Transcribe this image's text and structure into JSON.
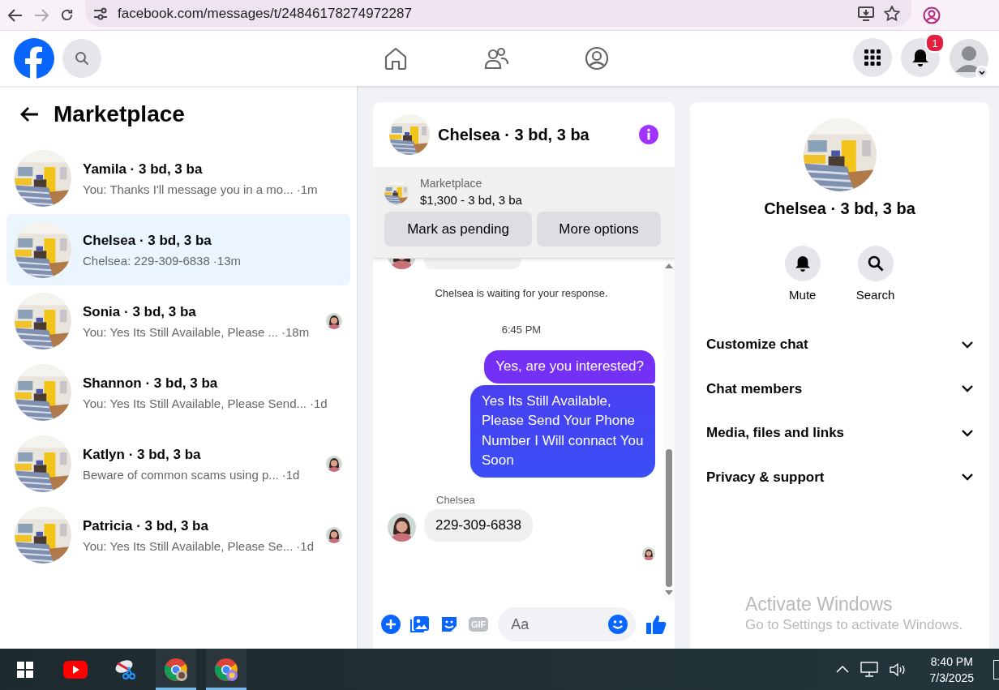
{
  "browser": {
    "url": "facebook.com/messages/t/24846178274972287"
  },
  "header": {
    "notification_badge": "1"
  },
  "sidebar": {
    "title": "Marketplace",
    "conversations": [
      {
        "name": "Yamila · 3 bd, 3 ba",
        "preview": "You: Thanks I'll message you in a mo...",
        "time": "·1m",
        "selected": false,
        "read_receipt": false
      },
      {
        "name": "Chelsea · 3 bd, 3 ba",
        "preview": "Chelsea: 229-309-6838",
        "time": "·13m",
        "selected": true,
        "read_receipt": false
      },
      {
        "name": "Sonia · 3 bd, 3 ba",
        "preview": "You: Yes Its Still Available, Please ...",
        "time": "·18m",
        "selected": false,
        "read_receipt": true
      },
      {
        "name": "Shannon · 3 bd, 3 ba",
        "preview": "You: Yes Its Still Available, Please Send...",
        "time": "·1d",
        "selected": false,
        "read_receipt": false
      },
      {
        "name": "Katlyn · 3 bd, 3 ba",
        "preview": "Beware of common scams using p...",
        "time": "·1d",
        "selected": false,
        "read_receipt": true
      },
      {
        "name": "Patricia · 3 bd, 3 ba",
        "preview": "You: Yes Its Still Available, Please Se...",
        "time": "·1d",
        "selected": false,
        "read_receipt": true
      }
    ]
  },
  "chat": {
    "title": "Chelsea · 3 bd, 3 ba",
    "listing": {
      "label": "Marketplace",
      "detail": "$1,300 - 3 bd, 3 ba"
    },
    "actions": [
      "Mark as pending",
      "More options"
    ],
    "messages": [
      {
        "kind": "partial"
      },
      {
        "kind": "notice",
        "text": "Chelsea is waiting for your response."
      },
      {
        "kind": "time",
        "text": "6:45 PM"
      },
      {
        "kind": "outgoing",
        "text": "Yes, are you interested?"
      },
      {
        "kind": "outgoing",
        "text": "Yes Its Still Available, Please Send Your Phone Number I Will connact You Soon"
      },
      {
        "kind": "sender",
        "text": "Chelsea"
      },
      {
        "kind": "incoming",
        "text": "229-309-6838"
      },
      {
        "kind": "seen"
      }
    ],
    "composer": {
      "placeholder": "Aa",
      "gif_label": "GIF"
    }
  },
  "details": {
    "title": "Chelsea · 3 bd, 3 ba",
    "actions": [
      {
        "kind": "mute",
        "label": "Mute"
      },
      {
        "kind": "search",
        "label": "Search"
      }
    ],
    "sections": [
      {
        "label": "Customize chat",
        "expanded": false
      },
      {
        "label": "Chat members",
        "expanded": false
      },
      {
        "label": "Media, files and links",
        "expanded": false
      },
      {
        "label": "Privacy & support",
        "expanded": false
      }
    ]
  },
  "activation_notice": {
    "title": "Activate Windows",
    "subtitle": "Go to Settings to activate Windows."
  },
  "taskbar": {
    "apps": [
      {
        "kind": "youtube",
        "running": false
      },
      {
        "kind": "snip",
        "running": false
      },
      {
        "kind": "chrome",
        "running": true
      },
      {
        "kind": "chrome-profile",
        "running": true
      }
    ],
    "time": "8:40 PM",
    "date": "7/3/2025"
  }
}
